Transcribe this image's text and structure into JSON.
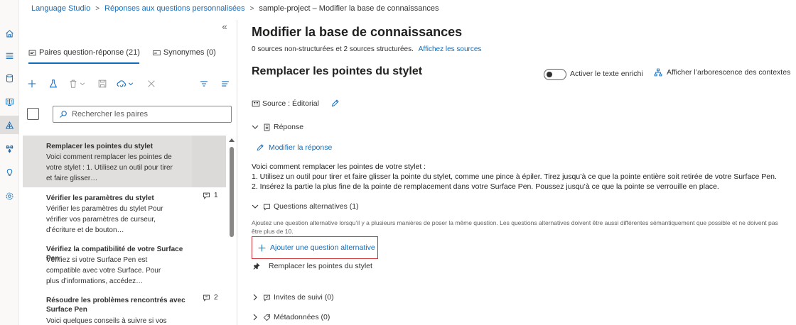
{
  "breadcrumb": {
    "items": [
      "Language Studio",
      "Réponses aux questions personnalisées"
    ],
    "current": "sample-project – Modifier la base de connaissances"
  },
  "nav": {
    "icons": [
      "home-icon",
      "list-icon",
      "database-icon",
      "book-icon",
      "knowledge-base-icon",
      "deploy-icon",
      "bulb-icon",
      "settings-icon"
    ],
    "active": "knowledge-base-icon"
  },
  "left": {
    "tabs": [
      {
        "label": "Paires question-réponse (21)",
        "icon": "qa-pairs-icon",
        "selected": true
      },
      {
        "label": "Synonymes (0)",
        "icon": "synonyms-icon",
        "selected": false
      }
    ],
    "search_placeholder": "Rechercher les paires",
    "items": [
      {
        "title": "Remplacer les pointes du stylet",
        "desc": [
          "Voici comment remplacer les pointes de",
          "votre stylet : 1. Utilisez un outil pour tirer",
          "et faire glisser…"
        ],
        "count": "",
        "selected": true
      },
      {
        "title": "Vérifier les paramètres du stylet",
        "desc": [
          "Vérifier les paramètres du stylet Pour",
          "vérifier vos paramètres de curseur,",
          "d’écriture et de bouton…"
        ],
        "count": "1",
        "selected": false
      },
      {
        "title": "Vérifiez la compatibilité de votre Surface Pen",
        "desc": [
          "Vérifiez si votre Surface Pen est",
          "compatible avec votre Surface. Pour",
          "plus d’informations, accédez…"
        ],
        "count": "",
        "selected": false
      },
      {
        "title": "Résoudre les problèmes rencontrés avec Surface Pen",
        "desc": [
          "Voici quelques conseils à suivre si vos"
        ],
        "count": "2",
        "selected": false
      }
    ]
  },
  "main": {
    "title": "Modifier la base de connaissances",
    "sources_text": "0 sources non-structurées et 2 sources structurées.",
    "sources_link": "Affichez les sources",
    "qa_title": "Remplacer les pointes du stylet",
    "rich_text_label": "Activer le texte enrichi",
    "rich_text_enabled": false,
    "tree_label": "Afficher l’arborescence des contextes",
    "source_label": "Source : Éditorial",
    "answer_section": "Réponse",
    "edit_answer": "Modifier la réponse",
    "answer_lines": [
      "Voici comment remplacer les pointes de votre stylet :",
      "1. Utilisez un outil pour tirer et faire glisser la pointe du stylet, comme une pince à épiler. Tirez jusqu’à ce que la pointe entière soit retirée de votre Surface Pen.",
      "2. Insérez la partie la plus fine de la pointe de remplacement dans votre Surface Pen. Poussez jusqu’à ce que la pointe se verrouille en place."
    ],
    "alt_section": "Questions alternatives (1)",
    "alt_hint": "Ajoutez une question alternative lorsqu’il y a plusieurs manières de poser la même question. Les questions alternatives doivent être aussi différentes sémantiquement que possible et ne doivent pas être plus de 10.",
    "add_alt": "Ajouter une question alternative",
    "alt_questions": [
      "Remplacer les pointes du stylet"
    ],
    "followup_section": "Invites de suivi (0)",
    "metadata_section": "Métadonnées (0)"
  },
  "colors": {
    "accent": "#0f6cbd",
    "highlight_border": "#d13438",
    "selected_bg": "#e1dfdd"
  }
}
